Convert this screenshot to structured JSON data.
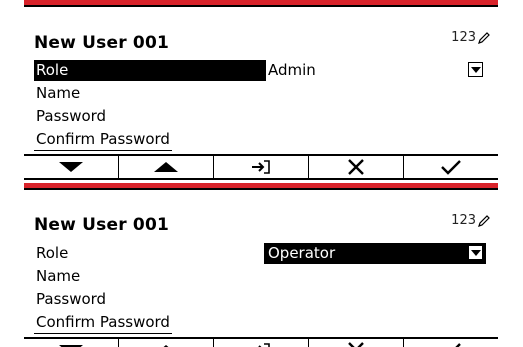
{
  "accent_color": "#d8232a",
  "screens": [
    {
      "title": "New User 001",
      "entry_mode": "123",
      "fields": [
        {
          "label": "Role",
          "value": "Admin",
          "selected_part": "label"
        },
        {
          "label": "Name"
        },
        {
          "label": "Password"
        },
        {
          "label": "Confirm Password"
        }
      ],
      "softkeys": [
        {
          "icon": "arrow-down-icon"
        },
        {
          "icon": "arrow-up-icon"
        },
        {
          "icon": "enter-icon"
        },
        {
          "icon": "cancel-x-icon"
        },
        {
          "icon": "confirm-check-icon"
        }
      ]
    },
    {
      "title": "New User 001",
      "entry_mode": "123",
      "fields": [
        {
          "label": "Role",
          "value": "Operator",
          "selected_part": "value"
        },
        {
          "label": "Name"
        },
        {
          "label": "Password"
        },
        {
          "label": "Confirm Password"
        }
      ],
      "softkeys": [
        {
          "icon": "arrow-down-icon"
        },
        {
          "icon": "arrow-up-icon"
        },
        {
          "icon": "enter-icon"
        },
        {
          "icon": "cancel-x-icon"
        },
        {
          "icon": "confirm-check-icon"
        }
      ]
    }
  ]
}
